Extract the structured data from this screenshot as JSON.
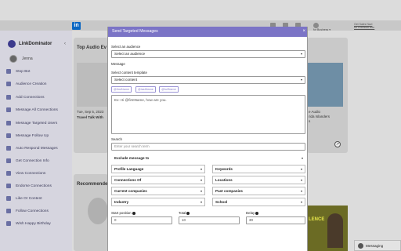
{
  "topbar": {
    "logo": "in",
    "right_line1": "Get Sales Navi",
    "right_line2": "for Premium Ben",
    "business_label": "for Business ▾"
  },
  "sidebar": {
    "app_name": "LinkDominator",
    "user_name": "Jenna",
    "items": [
      {
        "label": "Stop Bot"
      },
      {
        "label": "Audience Creation"
      },
      {
        "label": "Add Connections"
      },
      {
        "label": "Message All Connections"
      },
      {
        "label": "Message Targeted Users"
      },
      {
        "label": "Message Follow Up"
      },
      {
        "label": "Auto Respond Messages"
      },
      {
        "label": "Get Connection Info"
      },
      {
        "label": "View Connections"
      },
      {
        "label": "Endorse Connections"
      },
      {
        "label": "Like Or Content"
      },
      {
        "label": "Follow Connections"
      },
      {
        "label": "Wish Happy Birthday"
      }
    ]
  },
  "background": {
    "section_title": "Top Audio Ev",
    "event_date": "Tue, Sep 5, 2023",
    "event_title": "Travel Talk With",
    "right_card_line1": "e Audio",
    "right_card_line2": "rida Islanders",
    "right_card_line3": "s",
    "recommended_title": "Recommende",
    "banner_text": "LENCE"
  },
  "modal": {
    "title": "Send Targeted Messages",
    "audience_label": "Select an audience",
    "audience_value": "Select an audience",
    "message_label": "Message",
    "template_label": "Select content template",
    "template_value": "Select content",
    "chips": [
      "@firstName",
      "@lastName",
      "@fullName"
    ],
    "message_text": "Ex: Hi @firstName, how are you.",
    "search_label": "Search",
    "search_placeholder": "Enter your search term",
    "exclude_label": "Exclude message to",
    "filters": [
      {
        "label": "Profile Language"
      },
      {
        "label": "Keywords"
      },
      {
        "label": "Connections Of"
      },
      {
        "label": "Locations"
      },
      {
        "label": "Current companies"
      },
      {
        "label": "Past companies"
      },
      {
        "label": "Industry"
      },
      {
        "label": "School"
      }
    ],
    "start_position_label": "Start position",
    "start_position_value": "0",
    "total_label": "Total",
    "total_value": "10",
    "delay_label": "Delay",
    "delay_value": "30"
  },
  "messaging": {
    "label": "Messaging"
  },
  "colors": {
    "modal_header": "#7b74c6",
    "sidebar_bg": "#d6d5df",
    "linkedin_blue": "#0a66c2"
  }
}
